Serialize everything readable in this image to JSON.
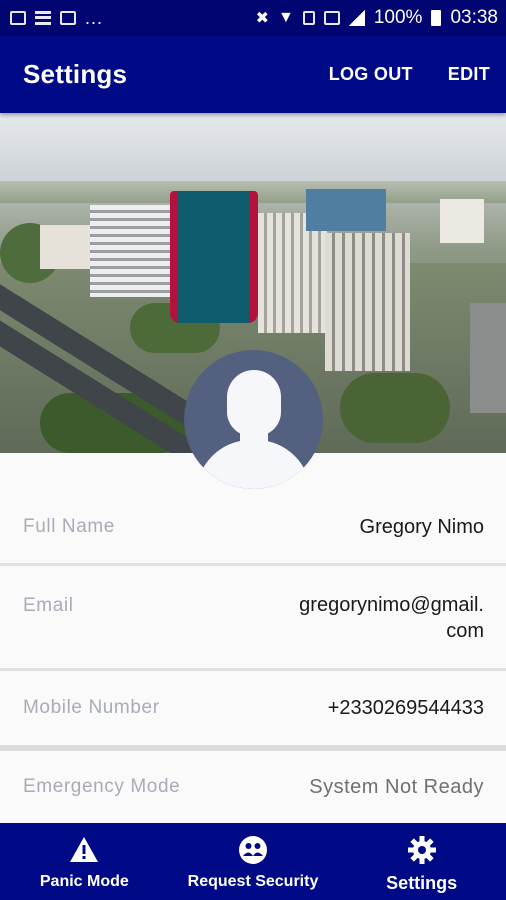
{
  "status_bar": {
    "more": "...",
    "battery": "100%",
    "time": "03:38",
    "icons_left": [
      "image-icon",
      "list-icon",
      "mail-icon"
    ],
    "icons_right": [
      "mute-icon",
      "wifi-icon",
      "sim-icon",
      "data-icon",
      "signal-icon",
      "battery-icon"
    ]
  },
  "app_bar": {
    "title": "Settings",
    "logout_label": "LOG OUT",
    "edit_label": "EDIT",
    "color": "#000a86"
  },
  "profile": {
    "avatar_icon": "user-silhouette-icon",
    "fields": [
      {
        "label": "Full Name",
        "value": "Gregory Nimo"
      },
      {
        "label": "Email",
        "value_line1": "gregorynimo@gmail.",
        "value_line2": "com"
      },
      {
        "label": "Mobile Number",
        "value": "+2330269544433"
      },
      {
        "label": "Emergency Mode",
        "value": "System Not Ready"
      }
    ]
  },
  "bottom_nav": {
    "items": [
      {
        "label": "Panic Mode",
        "icon": "warning-icon"
      },
      {
        "label": "Request Security",
        "icon": "security-icon"
      },
      {
        "label": "Settings",
        "icon": "gear-icon",
        "active": true
      }
    ]
  }
}
